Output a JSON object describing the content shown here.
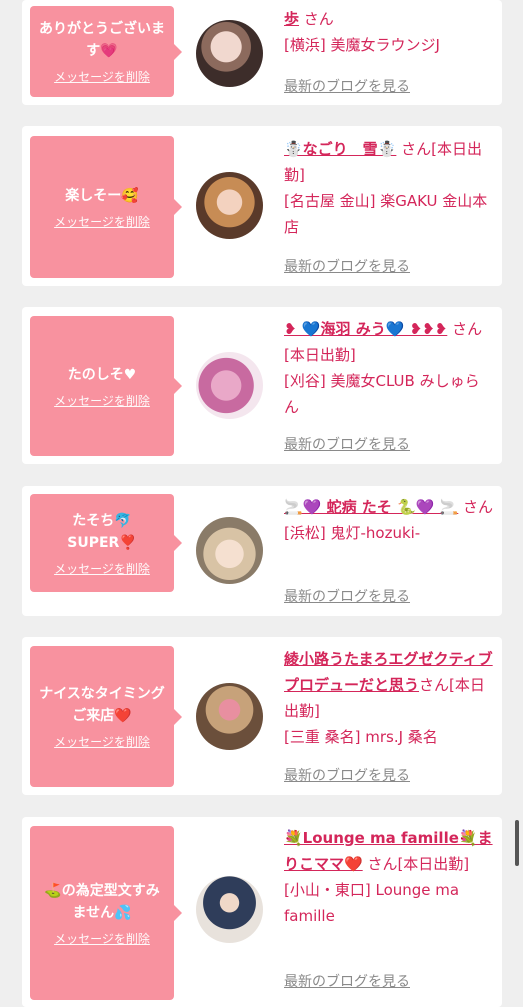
{
  "delete_label": "メッセージを削除",
  "blog_label": "最新のブログを見る",
  "cards": [
    {
      "message": "ありがとうございます💗",
      "name": "歩",
      "suffix": " さん",
      "store": "[横浜] 美魔女ラウンジJ"
    },
    {
      "message": "楽しそー🥰",
      "name": "☃️なごり　雪☃️",
      "suffix": " さん[本日出勤]",
      "store": "[名古屋 金山] 楽GAKU 金山本店"
    },
    {
      "message": "たのしそ♥",
      "name": "❥ 💙海羽 みう💙 ❥❥❥",
      "suffix": " さん[本日出勤]",
      "store": "[刈谷] 美魔女CLUB みしゅらん"
    },
    {
      "message": "たそち🐬 SUPER❣️",
      "name": "🚬💜 蛇病 たそ 🐍💜 🚬",
      "suffix": " さん",
      "store": "[浜松] 鬼灯-hozuki-"
    },
    {
      "message": "ナイスなタイミングご来店❤️",
      "name": "綾小路うたまろエグゼクティブプロデューだと思う",
      "suffix": "さん[本日出勤]",
      "store": "[三重 桑名] mrs.J 桑名"
    },
    {
      "message": "⛳️の為定型文すみません💦",
      "name": "💐Lounge ma famille💐まりこママ❤️",
      "suffix": " さん[本日出勤]",
      "store": "[小山・東口] Lounge ma famille"
    }
  ]
}
